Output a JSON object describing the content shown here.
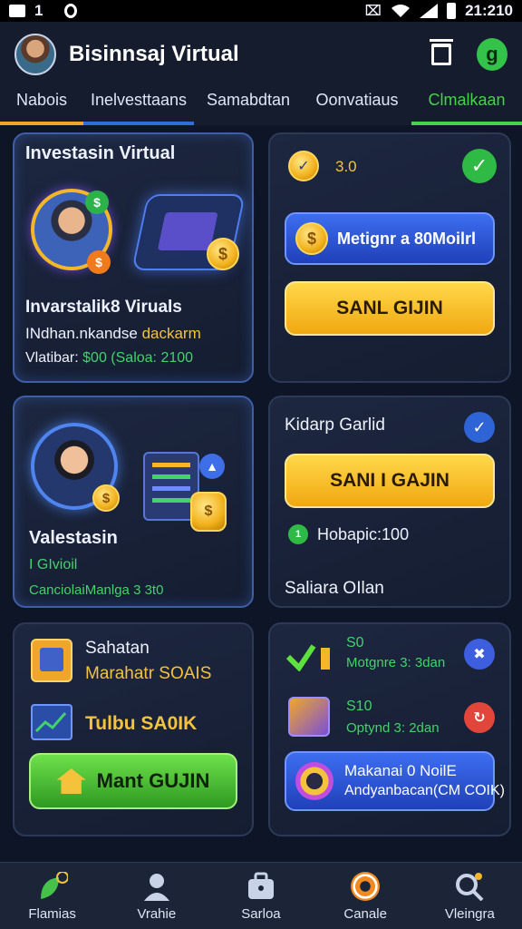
{
  "status_bar": {
    "left_text": "1",
    "time": "21:210"
  },
  "header": {
    "title": "Bisinnsaj Virtual"
  },
  "tabs": [
    {
      "label": "Nabois",
      "underline": "#f0a62a"
    },
    {
      "label": "Inelvesttaans",
      "underline": "#2f6fd8"
    },
    {
      "label": "Samabdtan",
      "underline": ""
    },
    {
      "label": "Oonvatiaus",
      "underline": ""
    },
    {
      "label": "Clmalkaan",
      "underline": "#46d24a"
    }
  ],
  "panel1": {
    "title": "Investasin Virtual",
    "subtitle": "Invarstalik8 Viruals",
    "line2_prefix": "INdhan.nkandse",
    "line2_highlight": "dackarm",
    "line3_prefix": "Vlatibar:",
    "line3_highlight": "$00 (Saloa: 2100"
  },
  "panel2": {
    "value": "3.0",
    "blue_button": "Metignr a 80Moilrl",
    "yellow_button": "SANL GIJIN"
  },
  "panel3": {
    "title": "Valestasin",
    "line2": "I GIvioil",
    "line3": "CanciolaiManlga 3 3t0"
  },
  "panel4": {
    "title": "Kidarp Garlid",
    "yellow_button": "SANI I GAJIN",
    "row_label": "Hobapic:100",
    "footer": "Saliara OIlan"
  },
  "panel5": {
    "title": "Sahatan",
    "line2": "Marahatr SOAIS",
    "line3": "Tulbu SA0IK",
    "green_button": "Mant GUJIN"
  },
  "panel6": {
    "row1_value": "S0",
    "row1_label": "Motgnre 3: 3dan",
    "row2_value": "S10",
    "row2_label": "Optynd 3: 2dan",
    "blue_button_line1": "Makanai 0 NoilE",
    "blue_button_line2": "Andyanbacan(CM COIK)"
  },
  "bottom_nav": [
    {
      "label": "Flamias",
      "icon": "plant-icon"
    },
    {
      "label": "Vrahie",
      "icon": "person-icon"
    },
    {
      "label": "Sarloa",
      "icon": "briefcase-icon"
    },
    {
      "label": "Canale",
      "icon": "target-coin-icon"
    },
    {
      "label": "Vleingra",
      "icon": "search-icon"
    }
  ],
  "colors": {
    "background": "#0e1526",
    "gold": "#f5c23c",
    "green_text": "#42d36a",
    "blue_accent": "#3d6ef0",
    "yellow_button": "#ffc928"
  }
}
